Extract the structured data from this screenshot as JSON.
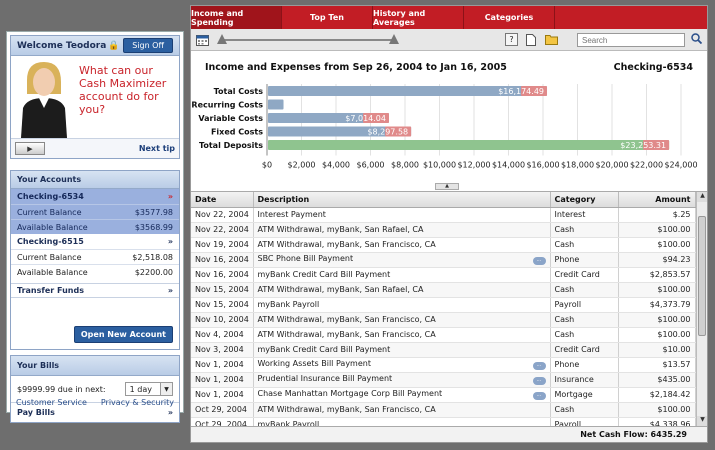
{
  "welcome": {
    "title": "Welcome Teodora",
    "signoff_label": "Sign Off",
    "promo_text": "What can our Cash Maximizer account do for you?",
    "next_tip_label": "Next tip"
  },
  "accounts": {
    "header": "Your Accounts",
    "items": [
      {
        "name": "Checking-6534",
        "selected": true,
        "current_label": "Current Balance",
        "current_value": "$3577.98",
        "available_label": "Available Balance",
        "available_value": "$3568.99"
      },
      {
        "name": "Checking-6515",
        "selected": false,
        "current_label": "Current Balance",
        "current_value": "$2,518.08",
        "available_label": "Available Balance",
        "available_value": "$2200.00"
      }
    ],
    "transfer_label": "Transfer Funds",
    "open_new_label": "Open New Account"
  },
  "bills": {
    "header": "Your Bills",
    "due_text": "$9999.99 due in next:",
    "period_selected": "1 day",
    "pay_label": "Pay Bills"
  },
  "footer_links": {
    "service": "Customer Service",
    "privacy": "Privacy & Security"
  },
  "tabs": [
    "Income and Spending",
    "Top Ten",
    "History and Averages",
    "Categories"
  ],
  "active_tab": 0,
  "toolbar": {
    "search_placeholder": "Search"
  },
  "chart_data": {
    "type": "bar",
    "title": "Income and Expenses from Sep 26, 2004 to Jan 16, 2005",
    "account": "Checking-6534",
    "orientation": "horizontal",
    "categories": [
      "Total Costs",
      "Recurring Costs",
      "Variable Costs",
      "Fixed Costs",
      "Total Deposits"
    ],
    "series": [
      {
        "values": [
          16174.49,
          900,
          7014.04,
          8297.58,
          23253.31
        ],
        "labels": [
          "$16,174.49",
          "",
          "$7,014.04",
          "$8,297.58",
          "$23,253.31"
        ]
      }
    ],
    "bar_colors": [
      "#8fa8c4",
      "#8fa8c4",
      "#8fa8c4",
      "#8fa8c4",
      "#8fc48f"
    ],
    "tip_color": "#e08a8a",
    "xlim": [
      0,
      24000
    ],
    "xticks": [
      "$0",
      "$2,000",
      "$4,000",
      "$6,000",
      "$8,000",
      "$10,000",
      "$12,000",
      "$14,000",
      "$16,000",
      "$18,000",
      "$20,000",
      "$22,000",
      "$24,000"
    ],
    "grid": true
  },
  "table": {
    "columns": [
      "Date",
      "Description",
      "Category",
      "Amount"
    ],
    "rows": [
      {
        "date": "Nov 22, 2004",
        "desc": "Interest Payment",
        "memo": false,
        "category": "Interest",
        "amount": "$.25"
      },
      {
        "date": "Nov 22, 2004",
        "desc": "ATM Withdrawal, myBank, San Rafael, CA",
        "memo": false,
        "category": "Cash",
        "amount": "$100.00"
      },
      {
        "date": "Nov 19, 2004",
        "desc": "ATM Withdrawal, myBank, San Francisco, CA",
        "memo": false,
        "category": "Cash",
        "amount": "$100.00"
      },
      {
        "date": "Nov 16, 2004",
        "desc": "SBC Phone Bill Payment",
        "memo": true,
        "category": "Phone",
        "amount": "$94.23"
      },
      {
        "date": "Nov 16, 2004",
        "desc": "myBank Credit Card Bill Payment",
        "memo": false,
        "category": "Credit Card",
        "amount": "$2,853.57"
      },
      {
        "date": "Nov 15, 2004",
        "desc": "ATM Withdrawal, myBank, San Rafael, CA",
        "memo": false,
        "category": "Cash",
        "amount": "$100.00"
      },
      {
        "date": "Nov 15, 2004",
        "desc": "myBank Payroll",
        "memo": false,
        "category": "Payroll",
        "amount": "$4,373.79"
      },
      {
        "date": "Nov 10, 2004",
        "desc": "ATM Withdrawal, myBank, San Francisco, CA",
        "memo": false,
        "category": "Cash",
        "amount": "$100.00"
      },
      {
        "date": "Nov 4, 2004",
        "desc": "ATM Withdrawal, myBank, San Francisco, CA",
        "memo": false,
        "category": "Cash",
        "amount": "$100.00"
      },
      {
        "date": "Nov 3, 2004",
        "desc": "myBank Credit Card Bill Payment",
        "memo": false,
        "category": "Credit Card",
        "amount": "$10.00"
      },
      {
        "date": "Nov 1, 2004",
        "desc": "Working Assets Bill Payment",
        "memo": true,
        "category": "Phone",
        "amount": "$13.57"
      },
      {
        "date": "Nov 1, 2004",
        "desc": "Prudential Insurance Bill Payment",
        "memo": true,
        "category": "Insurance",
        "amount": "$435.00"
      },
      {
        "date": "Nov 1, 2004",
        "desc": "Chase Manhattan Mortgage Corp Bill Payment",
        "memo": true,
        "category": "Mortgage",
        "amount": "$2,184.42"
      },
      {
        "date": "Oct 29, 2004",
        "desc": "ATM Withdrawal, myBank, San Francisco, CA",
        "memo": false,
        "category": "Cash",
        "amount": "$100.00"
      },
      {
        "date": "Oct 29, 2004",
        "desc": "myBank Payroll",
        "memo": false,
        "category": "Payroll",
        "amount": "$4,338.96"
      }
    ]
  },
  "net_cash_flow": "Net Cash Flow: 6435.29"
}
